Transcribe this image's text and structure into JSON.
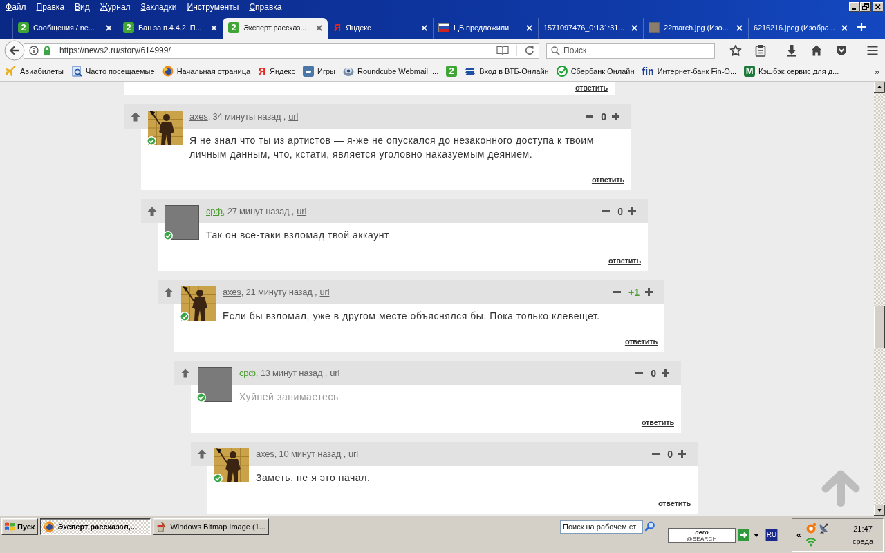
{
  "menu": [
    "Файл",
    "Правка",
    "Вид",
    "Журнал",
    "Закладки",
    "Инструменты",
    "Справка"
  ],
  "tabs": [
    {
      "label": "Сообщения / ne...",
      "kind": "tile",
      "logo": "2",
      "color": "#3fa535",
      "selected": false
    },
    {
      "label": "Бан за п.4.4.2. П...",
      "kind": "tile",
      "logo": "2",
      "color": "#3fa535",
      "selected": false
    },
    {
      "label": "Эксперт рассказ...",
      "kind": "tile",
      "logo": "2",
      "color": "#3fa535",
      "selected": true
    },
    {
      "label": "Яндекс",
      "kind": "letter",
      "logo": "Я",
      "color": "#e52620",
      "selected": false
    },
    {
      "label": "ЦБ предложили ...",
      "kind": "flag",
      "selected": false
    },
    {
      "label": "1571097476_0:131:31...",
      "kind": "blank",
      "selected": false
    },
    {
      "label": "22march.jpg (Изо...",
      "kind": "photo",
      "selected": false
    },
    {
      "label": "6216216.jpeg (Изобра...",
      "kind": "blank",
      "selected": false
    }
  ],
  "address": {
    "url": "https://news2.ru/story/614999/"
  },
  "search": {
    "placeholder": "Поиск"
  },
  "bookmarks": [
    {
      "label": "Авиабилеты",
      "kind": "plane"
    },
    {
      "label": "Часто посещаемые",
      "kind": "page"
    },
    {
      "label": "Начальная страница",
      "kind": "browser"
    },
    {
      "label": "Яндекс",
      "kind": "letter",
      "logo": "Я",
      "color": "#e52620"
    },
    {
      "label": "Игры",
      "kind": "social"
    },
    {
      "label": "Roundcube Webmail :...",
      "kind": "globe"
    },
    {
      "kind": "tile",
      "logo": "2",
      "color": "#3fa535"
    },
    {
      "label": "Вход в ВТБ-Онлайн",
      "kind": "stripes"
    },
    {
      "label": "Сбербанк Онлайн",
      "kind": "check"
    },
    {
      "label": "Интернет-банк Fin-O...",
      "kind": "letter",
      "logo": "fin",
      "color": "#1a3e8c"
    },
    {
      "label": "Кэшбэк сервис для д...",
      "kind": "tile",
      "logo": "M",
      "color": "#1e7a3a"
    }
  ],
  "bookmarks_overflow": "»",
  "comments": [
    {
      "reply": "ответить",
      "children": [
        {
          "author": {
            "name": "axes",
            "color": "#666666"
          },
          "avatar": {
            "kind": "silhouette"
          },
          "verified": true,
          "meta": ", 34 минуты назад ,",
          "url": "url",
          "score": {
            "text": "0",
            "color": "#444444"
          },
          "text": "Я не знал что ты из артистов — я-же не опускался до незаконного доступа к твоим личным данным, что, кстати, является уголовно наказуемым деянием.",
          "dimmed": false,
          "reply": "ответить",
          "children": [
            {
              "author": {
                "name": "срф",
                "color": "#4a9a2f"
              },
              "avatar": {
                "kind": "photo"
              },
              "verified": true,
              "meta": ", 27 минут назад ,",
              "url": "url",
              "score": {
                "text": "0",
                "color": "#444444"
              },
              "text": "Так он все-таки взломад твой аккаунт",
              "dimmed": false,
              "reply": "ответить",
              "children": [
                {
                  "author": {
                    "name": "axes",
                    "color": "#666666"
                  },
                  "avatar": {
                    "kind": "silhouette"
                  },
                  "verified": true,
                  "meta": ", 21 минуту назад ,",
                  "url": "url",
                  "score": {
                    "text": "+1",
                    "color": "#4a9a2f"
                  },
                  "text": "Если бы взломал, уже в другом месте объяснялся бы. Пока только клевещет.",
                  "dimmed": false,
                  "reply": "ответить",
                  "children": [
                    {
                      "author": {
                        "name": "срф",
                        "color": "#4a9a2f"
                      },
                      "avatar": {
                        "kind": "photo"
                      },
                      "verified": true,
                      "meta": ", 13 минут назад ,",
                      "url": "url",
                      "score": {
                        "text": "0",
                        "color": "#444444"
                      },
                      "text": "Хуйней занимаетесь",
                      "dimmed": true,
                      "reply": "ответить",
                      "children": [
                        {
                          "author": {
                            "name": "axes",
                            "color": "#666666"
                          },
                          "avatar": {
                            "kind": "silhouette"
                          },
                          "verified": true,
                          "meta": ", 10 минут назад ,",
                          "url": "url",
                          "score": {
                            "text": "0",
                            "color": "#444444"
                          },
                          "text": "Заметь, не я это начал.",
                          "dimmed": false,
                          "reply": "ответить"
                        }
                      ]
                    }
                  ]
                }
              ]
            }
          ]
        }
      ]
    }
  ],
  "taskbar": {
    "start": "Пуск",
    "buttons": [
      {
        "label": "Эксперт рассказал,...",
        "kind": "browser",
        "selected": true
      },
      {
        "label": "Windows Bitmap Image (1...",
        "kind": "paint",
        "selected": false
      }
    ],
    "search": {
      "placeholder": "Поиск на рабочем ст"
    },
    "logo": {
      "name": "nero",
      "sub": "@SEARCH"
    },
    "language": "RU",
    "tray_toggle": "«",
    "time": "21:47",
    "day": "среда"
  }
}
